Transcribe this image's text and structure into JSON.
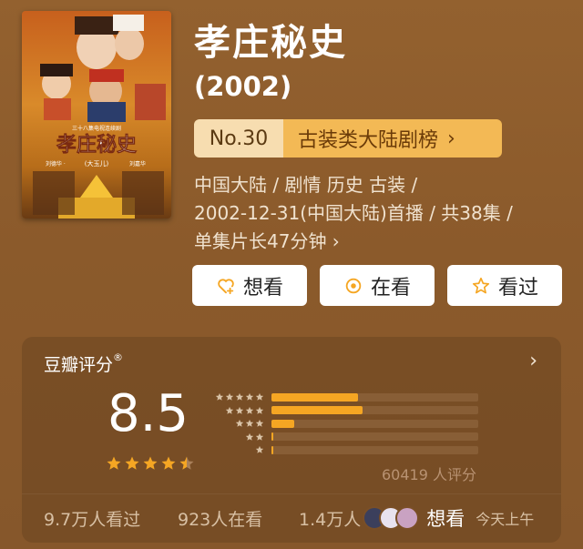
{
  "movie": {
    "title": "孝庄秘史",
    "year": "(2002)",
    "poster": {
      "top_caption": "三十八集电视连续剧",
      "title_text": "孝庄秘史",
      "subtitle": "(大玉儿)",
      "credit_left": "刘德华 ·",
      "credit_right": "刘嘉华"
    }
  },
  "rank": {
    "number": "No.30",
    "list_name": "古装类大陆剧榜",
    "chevron": "chevron-right-icon"
  },
  "meta": {
    "line1": "中国大陆 / 剧情 历史 古装 /",
    "line2": "2002-12-31(中国大陆)首播 / 共38集 /",
    "line3": "单集片长47分钟 ›"
  },
  "actions": {
    "want": {
      "label": "想看",
      "icon": "heart-plus-icon"
    },
    "watching": {
      "label": "在看",
      "icon": "circle-dot-icon"
    },
    "watched": {
      "label": "看过",
      "icon": "star-outline-icon"
    }
  },
  "rating": {
    "header": "豆瓣评分",
    "registered": "®",
    "score": "8.5",
    "stars": 4.5,
    "distribution": [
      {
        "stars": 5,
        "fraction": 0.42
      },
      {
        "stars": 4,
        "fraction": 0.44
      },
      {
        "stars": 3,
        "fraction": 0.11
      },
      {
        "stars": 2,
        "fraction": 0.01
      },
      {
        "stars": 1,
        "fraction": 0.01
      }
    ],
    "count_text": "60419 人评分"
  },
  "stats": {
    "seen": "9.7万人看过",
    "watching": "923人在看",
    "want_count": "1.4万人",
    "want_label": "想看",
    "time": "今天上午"
  },
  "colors": {
    "background": "#8b5a2b",
    "accent": "#f5a623",
    "rank_left": "#f7ddb0",
    "rank_right": "#f3b955"
  }
}
